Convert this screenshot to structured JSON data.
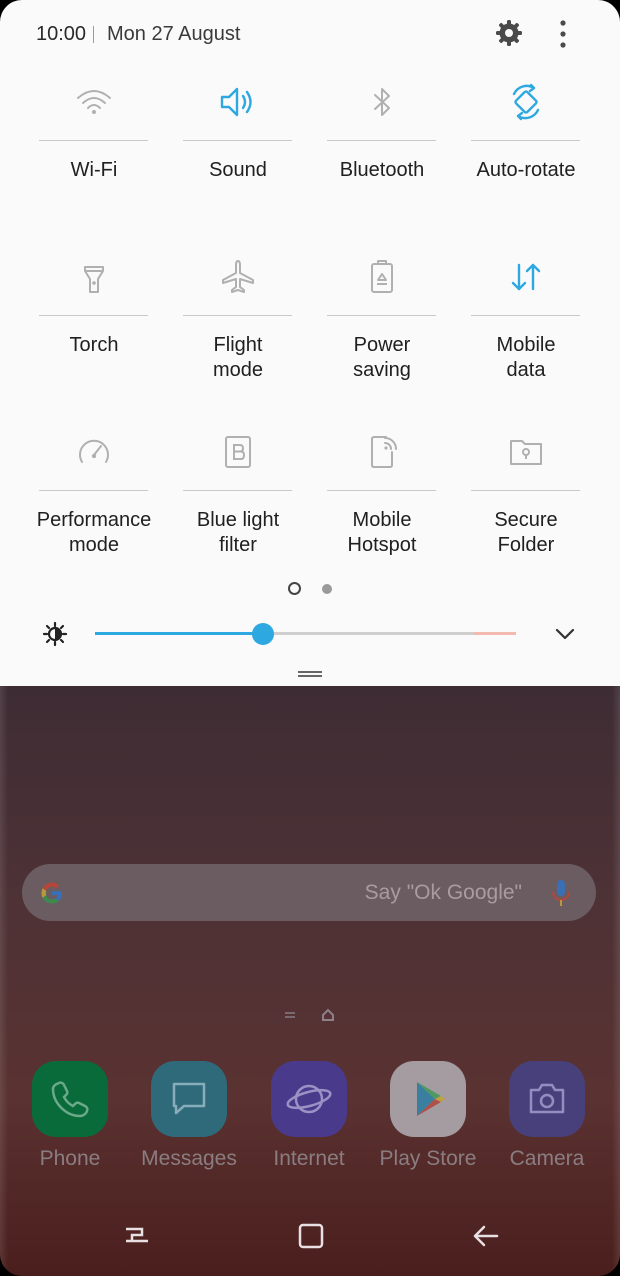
{
  "status": {
    "time": "10:00",
    "date": "Mon 27 August"
  },
  "tiles": [
    {
      "label": "Wi-Fi",
      "icon": "wifi-icon",
      "active": false
    },
    {
      "label": "Sound",
      "icon": "speaker-icon",
      "active": true
    },
    {
      "label": "Bluetooth",
      "icon": "bluetooth-icon",
      "active": false
    },
    {
      "label": "Auto-rotate",
      "icon": "auto-rotate-icon",
      "active": true
    },
    {
      "label": "Torch",
      "icon": "torch-icon",
      "active": false
    },
    {
      "label": "Flight\nmode",
      "icon": "airplane-icon",
      "active": false
    },
    {
      "label": "Power\nsaving",
      "icon": "battery-recycle-icon",
      "active": false
    },
    {
      "label": "Mobile\ndata",
      "icon": "data-arrows-icon",
      "active": true
    },
    {
      "label": "Performance\nmode",
      "icon": "speedometer-icon",
      "active": false
    },
    {
      "label": "Blue light\nfilter",
      "icon": "blue-light-b-icon",
      "active": false
    },
    {
      "label": "Mobile\nHotspot",
      "icon": "hotspot-icon",
      "active": false
    },
    {
      "label": "Secure\nFolder",
      "icon": "secure-folder-icon",
      "active": false
    }
  ],
  "page_dots": {
    "count": 2,
    "current": 1
  },
  "brightness": {
    "level": 0.4
  },
  "search": {
    "hint": "Say \"Ok Google\""
  },
  "dock": [
    {
      "label": "Phone",
      "icon": "phone-icon",
      "color": "#0a6b3a"
    },
    {
      "label": "Messages",
      "icon": "messages-icon",
      "color": "#2f6a7a"
    },
    {
      "label": "Internet",
      "icon": "internet-icon",
      "color": "#4a3a8c"
    },
    {
      "label": "Play Store",
      "icon": "play-store-icon",
      "color": "#a49ca0"
    },
    {
      "label": "Camera",
      "icon": "camera-icon",
      "color": "#48407a"
    }
  ],
  "colors": {
    "accent": "#2ea8e0",
    "inactive_icon": "#a8a8a8",
    "panel_bg": "#fafafa"
  }
}
